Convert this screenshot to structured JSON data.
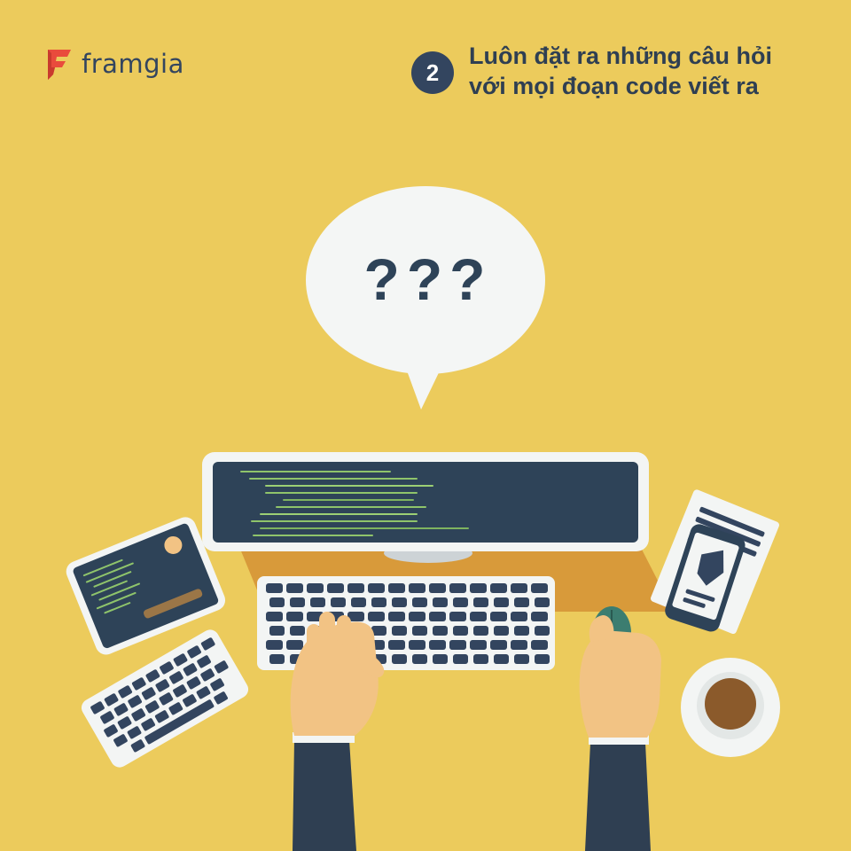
{
  "brand": {
    "name": "framgia",
    "logo_icon": "framgia-f-logo",
    "accent": "#e94b3c"
  },
  "headline": {
    "step_number": "2",
    "line1": "Luôn đặt ra những câu hỏi",
    "line2": "với mọi đoạn code viết ra"
  },
  "speech_bubble": {
    "text": "???"
  },
  "colors": {
    "background": "#eccb5c",
    "navy": "#33455f",
    "screen": "#2e4358",
    "code_green": "#8fc46b",
    "skin": "#f2c384",
    "coffee": "#8b5a2b"
  }
}
